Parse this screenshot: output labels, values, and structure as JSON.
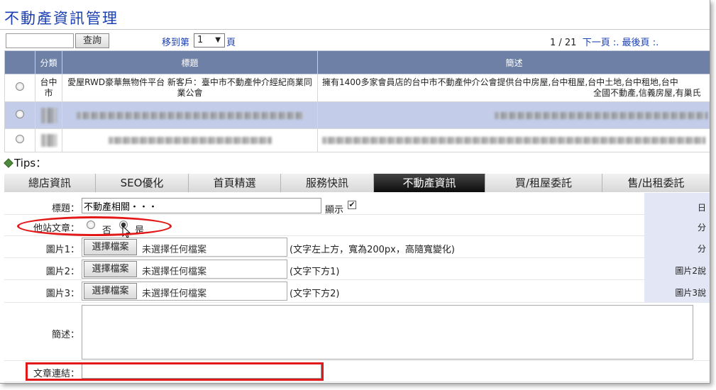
{
  "page_title": "不動產資訊管理",
  "toolbar": {
    "search_value": "",
    "query_label": "查詢",
    "goto_prefix": "移到第",
    "page_value": "1",
    "goto_suffix": "頁",
    "pager_count": "1 / 21",
    "next_label": "下一頁",
    "sep": ":.",
    "last_label": "最後頁",
    "sep2": ":."
  },
  "table": {
    "headers": [
      "分類",
      "標題",
      "簡述"
    ],
    "rows": [
      {
        "category": "台中市",
        "title": "愛屋RWD豪華無物件平台 新客戶：臺中市不動產仲介經紀商業同業公會",
        "summary": "擁有1400多家會員店的台中市不動產仲介公會提供台中房屋,台中租屋,台中土地,台中租地,台中",
        "summary2": "全國不動產,信義房屋,有巢氏"
      },
      {
        "category": "",
        "title": "",
        "summary": ""
      },
      {
        "category": "",
        "title": "",
        "summary": ""
      }
    ]
  },
  "tips_label": "Tips：",
  "tabs": [
    "總店資訊",
    "SEO優化",
    "首頁精選",
    "服務快訊",
    "不動產資訊",
    "買/租屋委託",
    "售/出租委託"
  ],
  "active_tab": "不動產資訊",
  "form": {
    "title_label": "標題：",
    "title_value": "不動產相關・・・",
    "show_label": "顯示",
    "other_site_label": "他站文章：",
    "option_no": "否",
    "option_yes": "是",
    "image1_label": "圖片1：",
    "image2_label": "圖片2：",
    "image3_label": "圖片3：",
    "choose_file": "選擇檔案",
    "no_file": "未選擇任何檔案",
    "hint1": "(文字左上方，寬為200px，高隨寬變化)",
    "hint2": "(文字下方1)",
    "hint3": "(文字下方2)",
    "summary_label": "簡述：",
    "summary_value": "",
    "link_label": "文章連結：",
    "link_value": "",
    "side_labels": [
      "日",
      "分",
      "分",
      "圖片2說",
      "圖片3說"
    ]
  }
}
